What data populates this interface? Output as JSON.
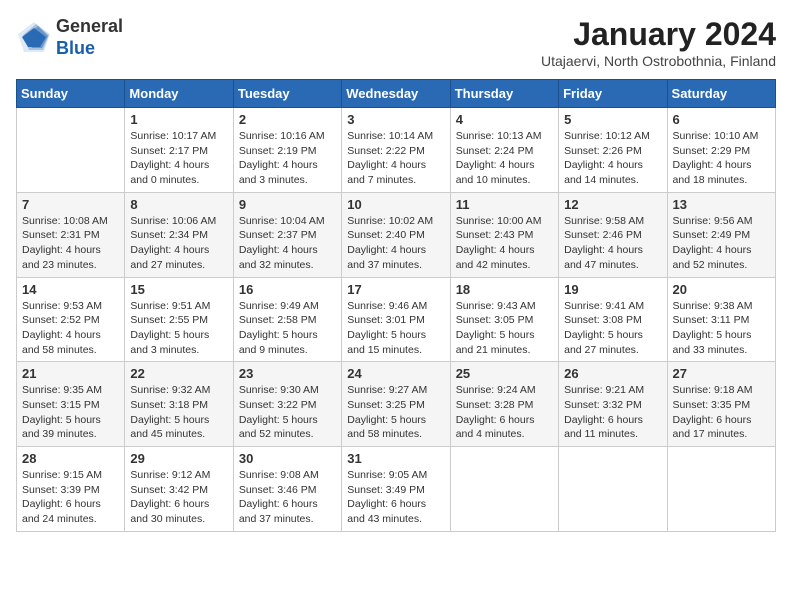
{
  "header": {
    "logo": {
      "general": "General",
      "blue": "Blue"
    },
    "month_year": "January 2024",
    "location": "Utajaervi, North Ostrobothnia, Finland"
  },
  "weekdays": [
    "Sunday",
    "Monday",
    "Tuesday",
    "Wednesday",
    "Thursday",
    "Friday",
    "Saturday"
  ],
  "weeks": [
    [
      {
        "day": null
      },
      {
        "day": 1,
        "sunrise": "10:17 AM",
        "sunset": "2:17 PM",
        "daylight": "4 hours and 0 minutes."
      },
      {
        "day": 2,
        "sunrise": "10:16 AM",
        "sunset": "2:19 PM",
        "daylight": "4 hours and 3 minutes."
      },
      {
        "day": 3,
        "sunrise": "10:14 AM",
        "sunset": "2:22 PM",
        "daylight": "4 hours and 7 minutes."
      },
      {
        "day": 4,
        "sunrise": "10:13 AM",
        "sunset": "2:24 PM",
        "daylight": "4 hours and 10 minutes."
      },
      {
        "day": 5,
        "sunrise": "10:12 AM",
        "sunset": "2:26 PM",
        "daylight": "4 hours and 14 minutes."
      },
      {
        "day": 6,
        "sunrise": "10:10 AM",
        "sunset": "2:29 PM",
        "daylight": "4 hours and 18 minutes."
      }
    ],
    [
      {
        "day": 7,
        "sunrise": "10:08 AM",
        "sunset": "2:31 PM",
        "daylight": "4 hours and 23 minutes."
      },
      {
        "day": 8,
        "sunrise": "10:06 AM",
        "sunset": "2:34 PM",
        "daylight": "4 hours and 27 minutes."
      },
      {
        "day": 9,
        "sunrise": "10:04 AM",
        "sunset": "2:37 PM",
        "daylight": "4 hours and 32 minutes."
      },
      {
        "day": 10,
        "sunrise": "10:02 AM",
        "sunset": "2:40 PM",
        "daylight": "4 hours and 37 minutes."
      },
      {
        "day": 11,
        "sunrise": "10:00 AM",
        "sunset": "2:43 PM",
        "daylight": "4 hours and 42 minutes."
      },
      {
        "day": 12,
        "sunrise": "9:58 AM",
        "sunset": "2:46 PM",
        "daylight": "4 hours and 47 minutes."
      },
      {
        "day": 13,
        "sunrise": "9:56 AM",
        "sunset": "2:49 PM",
        "daylight": "4 hours and 52 minutes."
      }
    ],
    [
      {
        "day": 14,
        "sunrise": "9:53 AM",
        "sunset": "2:52 PM",
        "daylight": "4 hours and 58 minutes."
      },
      {
        "day": 15,
        "sunrise": "9:51 AM",
        "sunset": "2:55 PM",
        "daylight": "5 hours and 3 minutes."
      },
      {
        "day": 16,
        "sunrise": "9:49 AM",
        "sunset": "2:58 PM",
        "daylight": "5 hours and 9 minutes."
      },
      {
        "day": 17,
        "sunrise": "9:46 AM",
        "sunset": "3:01 PM",
        "daylight": "5 hours and 15 minutes."
      },
      {
        "day": 18,
        "sunrise": "9:43 AM",
        "sunset": "3:05 PM",
        "daylight": "5 hours and 21 minutes."
      },
      {
        "day": 19,
        "sunrise": "9:41 AM",
        "sunset": "3:08 PM",
        "daylight": "5 hours and 27 minutes."
      },
      {
        "day": 20,
        "sunrise": "9:38 AM",
        "sunset": "3:11 PM",
        "daylight": "5 hours and 33 minutes."
      }
    ],
    [
      {
        "day": 21,
        "sunrise": "9:35 AM",
        "sunset": "3:15 PM",
        "daylight": "5 hours and 39 minutes."
      },
      {
        "day": 22,
        "sunrise": "9:32 AM",
        "sunset": "3:18 PM",
        "daylight": "5 hours and 45 minutes."
      },
      {
        "day": 23,
        "sunrise": "9:30 AM",
        "sunset": "3:22 PM",
        "daylight": "5 hours and 52 minutes."
      },
      {
        "day": 24,
        "sunrise": "9:27 AM",
        "sunset": "3:25 PM",
        "daylight": "5 hours and 58 minutes."
      },
      {
        "day": 25,
        "sunrise": "9:24 AM",
        "sunset": "3:28 PM",
        "daylight": "6 hours and 4 minutes."
      },
      {
        "day": 26,
        "sunrise": "9:21 AM",
        "sunset": "3:32 PM",
        "daylight": "6 hours and 11 minutes."
      },
      {
        "day": 27,
        "sunrise": "9:18 AM",
        "sunset": "3:35 PM",
        "daylight": "6 hours and 17 minutes."
      }
    ],
    [
      {
        "day": 28,
        "sunrise": "9:15 AM",
        "sunset": "3:39 PM",
        "daylight": "6 hours and 24 minutes."
      },
      {
        "day": 29,
        "sunrise": "9:12 AM",
        "sunset": "3:42 PM",
        "daylight": "6 hours and 30 minutes."
      },
      {
        "day": 30,
        "sunrise": "9:08 AM",
        "sunset": "3:46 PM",
        "daylight": "6 hours and 37 minutes."
      },
      {
        "day": 31,
        "sunrise": "9:05 AM",
        "sunset": "3:49 PM",
        "daylight": "6 hours and 43 minutes."
      },
      {
        "day": null
      },
      {
        "day": null
      },
      {
        "day": null
      }
    ]
  ]
}
